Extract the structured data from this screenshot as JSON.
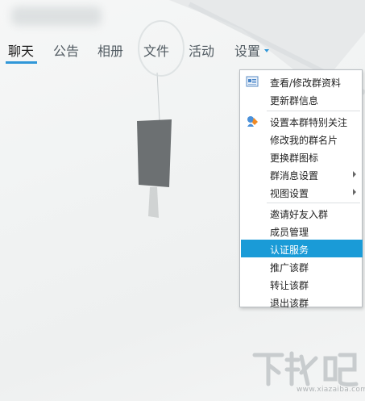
{
  "tabs": [
    {
      "label": "聊天",
      "active": true
    },
    {
      "label": "公告",
      "active": false
    },
    {
      "label": "相册",
      "active": false
    },
    {
      "label": "文件",
      "active": false
    },
    {
      "label": "活动",
      "active": false
    },
    {
      "label": "设置",
      "active": false,
      "has_dropdown": true
    }
  ],
  "accent_color": "#2f97d8",
  "highlight_color": "#1a9bd7",
  "settings_menu": {
    "items": [
      {
        "label": "查看/修改群资料",
        "icon": "group-card-icon"
      },
      {
        "label": "更新群信息"
      },
      {
        "label": "设置本群特别关注",
        "icon": "special-attention-icon"
      },
      {
        "label": "修改我的群名片"
      },
      {
        "label": "更换群图标"
      },
      {
        "label": "群消息设置",
        "submenu": true
      },
      {
        "label": "视图设置",
        "submenu": true
      },
      {
        "label": "邀请好友入群"
      },
      {
        "label": "成员管理"
      },
      {
        "label": "认证服务",
        "highlighted": true
      },
      {
        "label": "推广该群"
      },
      {
        "label": "转让该群"
      },
      {
        "label": "退出该群"
      }
    ]
  },
  "watermark": {
    "logo_text": "下载吧",
    "url_text": "www.xiazaiba.com"
  }
}
